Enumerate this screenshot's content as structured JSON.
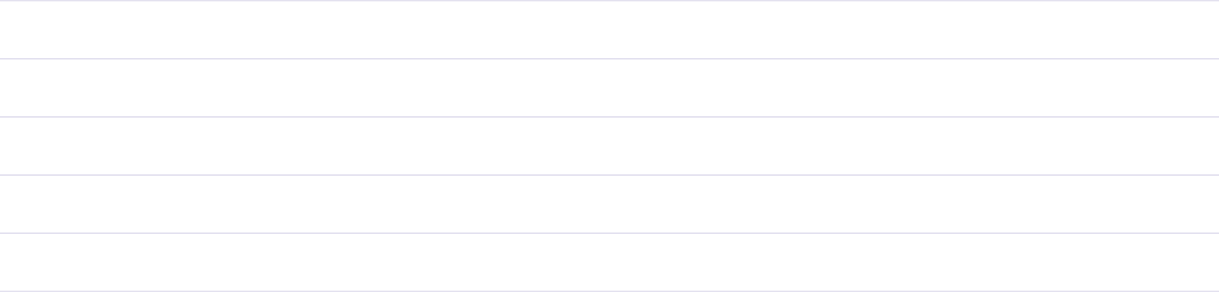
{
  "list": {
    "rows": [
      {
        "label": ""
      },
      {
        "label": ""
      },
      {
        "label": ""
      },
      {
        "label": ""
      },
      {
        "label": ""
      }
    ]
  },
  "colors": {
    "divider": "#e3e1ef",
    "background": "#ffffff"
  }
}
